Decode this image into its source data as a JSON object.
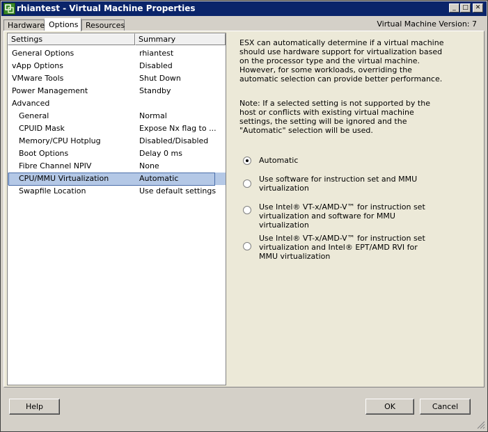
{
  "window": {
    "title": "rhiantest - Virtual Machine Properties",
    "version_label": "Virtual Machine Version: 7",
    "controls": {
      "minimize": "_",
      "maximize": "□",
      "close": "✕"
    }
  },
  "tabs": [
    {
      "label": "Hardware",
      "active": false
    },
    {
      "label": "Options",
      "active": true
    },
    {
      "label": "Resources",
      "active": false
    }
  ],
  "settings_list": {
    "columns": [
      "Settings",
      "Summary"
    ],
    "rows": [
      {
        "setting": "General Options",
        "summary": "rhiantest",
        "indent": false
      },
      {
        "setting": "vApp Options",
        "summary": "Disabled",
        "indent": false
      },
      {
        "setting": "VMware Tools",
        "summary": "Shut Down",
        "indent": false
      },
      {
        "setting": "Power Management",
        "summary": "Standby",
        "indent": false
      },
      {
        "setting": "Advanced",
        "summary": "",
        "indent": false
      },
      {
        "setting": "General",
        "summary": "Normal",
        "indent": true
      },
      {
        "setting": "CPUID Mask",
        "summary": "Expose Nx flag to ...",
        "indent": true
      },
      {
        "setting": "Memory/CPU Hotplug",
        "summary": "Disabled/Disabled",
        "indent": true
      },
      {
        "setting": "Boot Options",
        "summary": "Delay 0 ms",
        "indent": true
      },
      {
        "setting": "Fibre Channel NPIV",
        "summary": "None",
        "indent": true
      },
      {
        "setting": "CPU/MMU Virtualization",
        "summary": "Automatic",
        "indent": true,
        "selected": true
      },
      {
        "setting": "Swapfile Location",
        "summary": "Use default settings",
        "indent": true
      }
    ]
  },
  "detail": {
    "description": "ESX can automatically determine if a virtual machine should use hardware support for virtualization based on the processor type and the virtual machine. However, for some workloads, overriding the automatic selection can provide better performance.",
    "note": "Note: If a selected setting is not supported by the host or conflicts with existing virtual machine settings, the setting will be ignored and the \"Automatic\" selection will be used.",
    "options": [
      {
        "label": "Automatic",
        "checked": true
      },
      {
        "label": "Use software for instruction set and MMU virtualization",
        "checked": false
      },
      {
        "label": "Use Intel® VT-x/AMD-V™ for instruction set virtualization and software for MMU virtualization",
        "checked": false
      },
      {
        "label": "Use Intel® VT-x/AMD-V™ for instruction set virtualization and Intel® EPT/AMD RVI for MMU virtualization",
        "checked": false
      }
    ]
  },
  "buttons": {
    "help": "Help",
    "ok": "OK",
    "cancel": "Cancel"
  },
  "colors": {
    "titlebar": "#0a246a",
    "selection": "#b4c8e6",
    "face": "#d4d0c8"
  }
}
